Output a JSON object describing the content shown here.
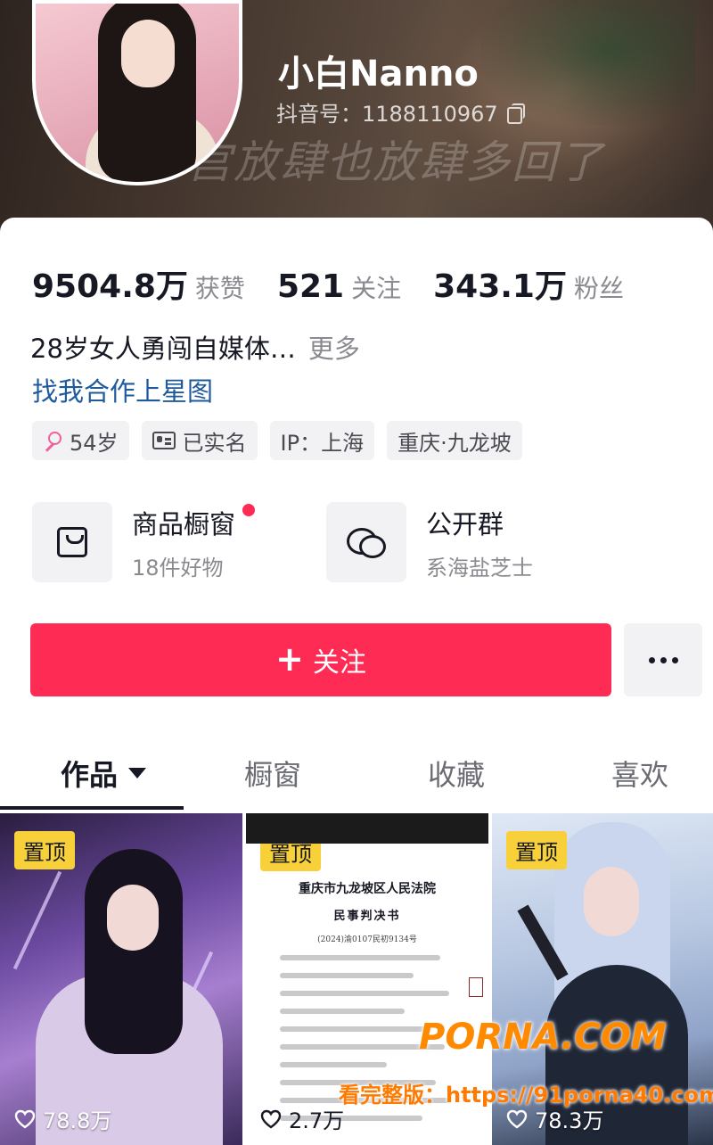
{
  "profile": {
    "nickname": "小白Nanno",
    "douyin_id": "抖音号：1188110967",
    "banner_caption": "宫放肆也放肆多回了"
  },
  "stats": [
    {
      "value": "9504.8万",
      "label": "获赞"
    },
    {
      "value": "521",
      "label": "关注"
    },
    {
      "value": "343.1万",
      "label": "粉丝"
    }
  ],
  "bio": {
    "text": "28岁女人勇闯自媒体…",
    "more": "更多"
  },
  "collab_link": "找我合作上星图",
  "tags": {
    "age": "54岁",
    "verified": "已实名",
    "ip": "IP：上海",
    "location": "重庆·九龙坡"
  },
  "shop": {
    "title": "商品橱窗",
    "subtitle": "18件好物"
  },
  "group": {
    "title": "公开群",
    "subtitle": "系海盐芝士"
  },
  "follow_button": "关注",
  "tabs": [
    "作品",
    "橱窗",
    "收藏",
    "喜欢"
  ],
  "videos": [
    {
      "badge": "置顶",
      "likes": "78.8万"
    },
    {
      "badge": "置顶",
      "likes": "2.7万",
      "doc_court": "重庆市九龙坡区人民法院",
      "doc_title": "民事判决书",
      "doc_case": "(2024)渝0107民初9134号"
    },
    {
      "badge": "置顶",
      "likes": "78.3万"
    }
  ],
  "watermark": {
    "brand": "PORNA.COM",
    "url": "看完整版：https://91porna40.com"
  },
  "colors": {
    "accent": "#fe2c55",
    "link": "#1e5a9c",
    "badge": "#f8d13a"
  }
}
